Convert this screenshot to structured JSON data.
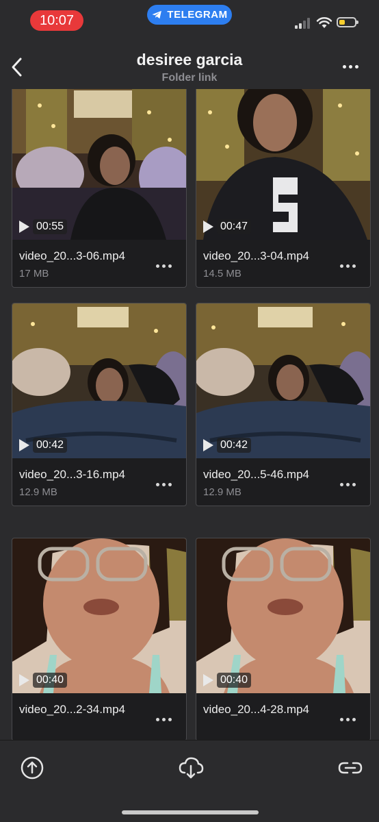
{
  "status_bar": {
    "time": "10:07",
    "app_badge": "TELEGRAM",
    "battery_color": "#f7ce2e"
  },
  "header": {
    "title": "desiree garcia",
    "subtitle": "Folder link",
    "back_icon": "chevron-left-icon",
    "more_icon": "more-horizontal-icon"
  },
  "files": [
    {
      "name": "video_20...3-06.mp4",
      "size": "17 MB",
      "duration": "00:55"
    },
    {
      "name": "video_20...3-04.mp4",
      "size": "14.5 MB",
      "duration": "00:47"
    },
    {
      "name": "video_20...3-16.mp4",
      "size": "12.9 MB",
      "duration": "00:42"
    },
    {
      "name": "video_20...5-46.mp4",
      "size": "12.9 MB",
      "duration": "00:42"
    },
    {
      "name": "video_20...2-34.mp4",
      "size": "",
      "duration": "00:40"
    },
    {
      "name": "video_20...4-28.mp4",
      "size": "",
      "duration": "00:40"
    }
  ],
  "bottom_bar": {
    "actions": [
      "upload-icon",
      "cloud-download-icon",
      "link-icon"
    ]
  },
  "colors": {
    "background": "#2b2b2d",
    "card": "#1d1d1f",
    "time_pill": "#e8393a",
    "telegram_pill": "#2d7ef0"
  }
}
